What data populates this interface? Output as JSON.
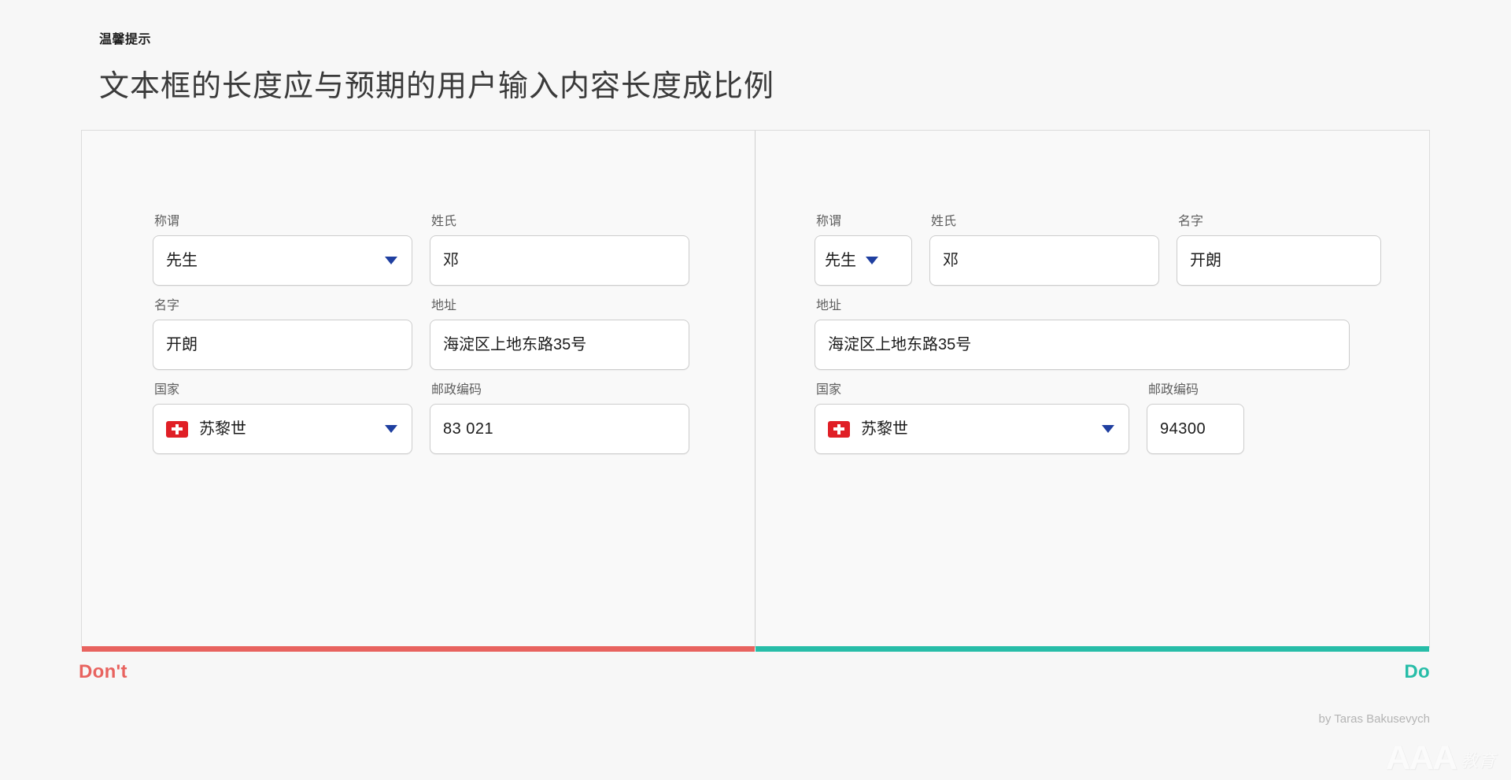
{
  "header": {
    "eyebrow": "温馨提示",
    "headline": "文本框的长度应与预期的用户输入内容长度成比例"
  },
  "labels": {
    "title": "称谓",
    "surname": "姓氏",
    "given_name": "名字",
    "address": "地址",
    "country": "国家",
    "postal_code": "邮政编码"
  },
  "dont_panel": {
    "verdict": "Don't",
    "accent_color": "#e8635f",
    "fields": {
      "title": "先生",
      "surname": "邓",
      "given_name": "开朗",
      "address": "海淀区上地东路35号",
      "country": "苏黎世",
      "postal_code": "83 021"
    }
  },
  "do_panel": {
    "verdict": "Do",
    "accent_color": "#27bda8",
    "fields": {
      "title": "先生",
      "surname": "邓",
      "given_name": "开朗",
      "address": "海淀区上地东路35号",
      "country": "苏黎世",
      "postal_code": "94300"
    }
  },
  "footer": {
    "credit": "by Taras Bakusevych",
    "watermark_latin": "AAA",
    "watermark_cn": "教育"
  }
}
